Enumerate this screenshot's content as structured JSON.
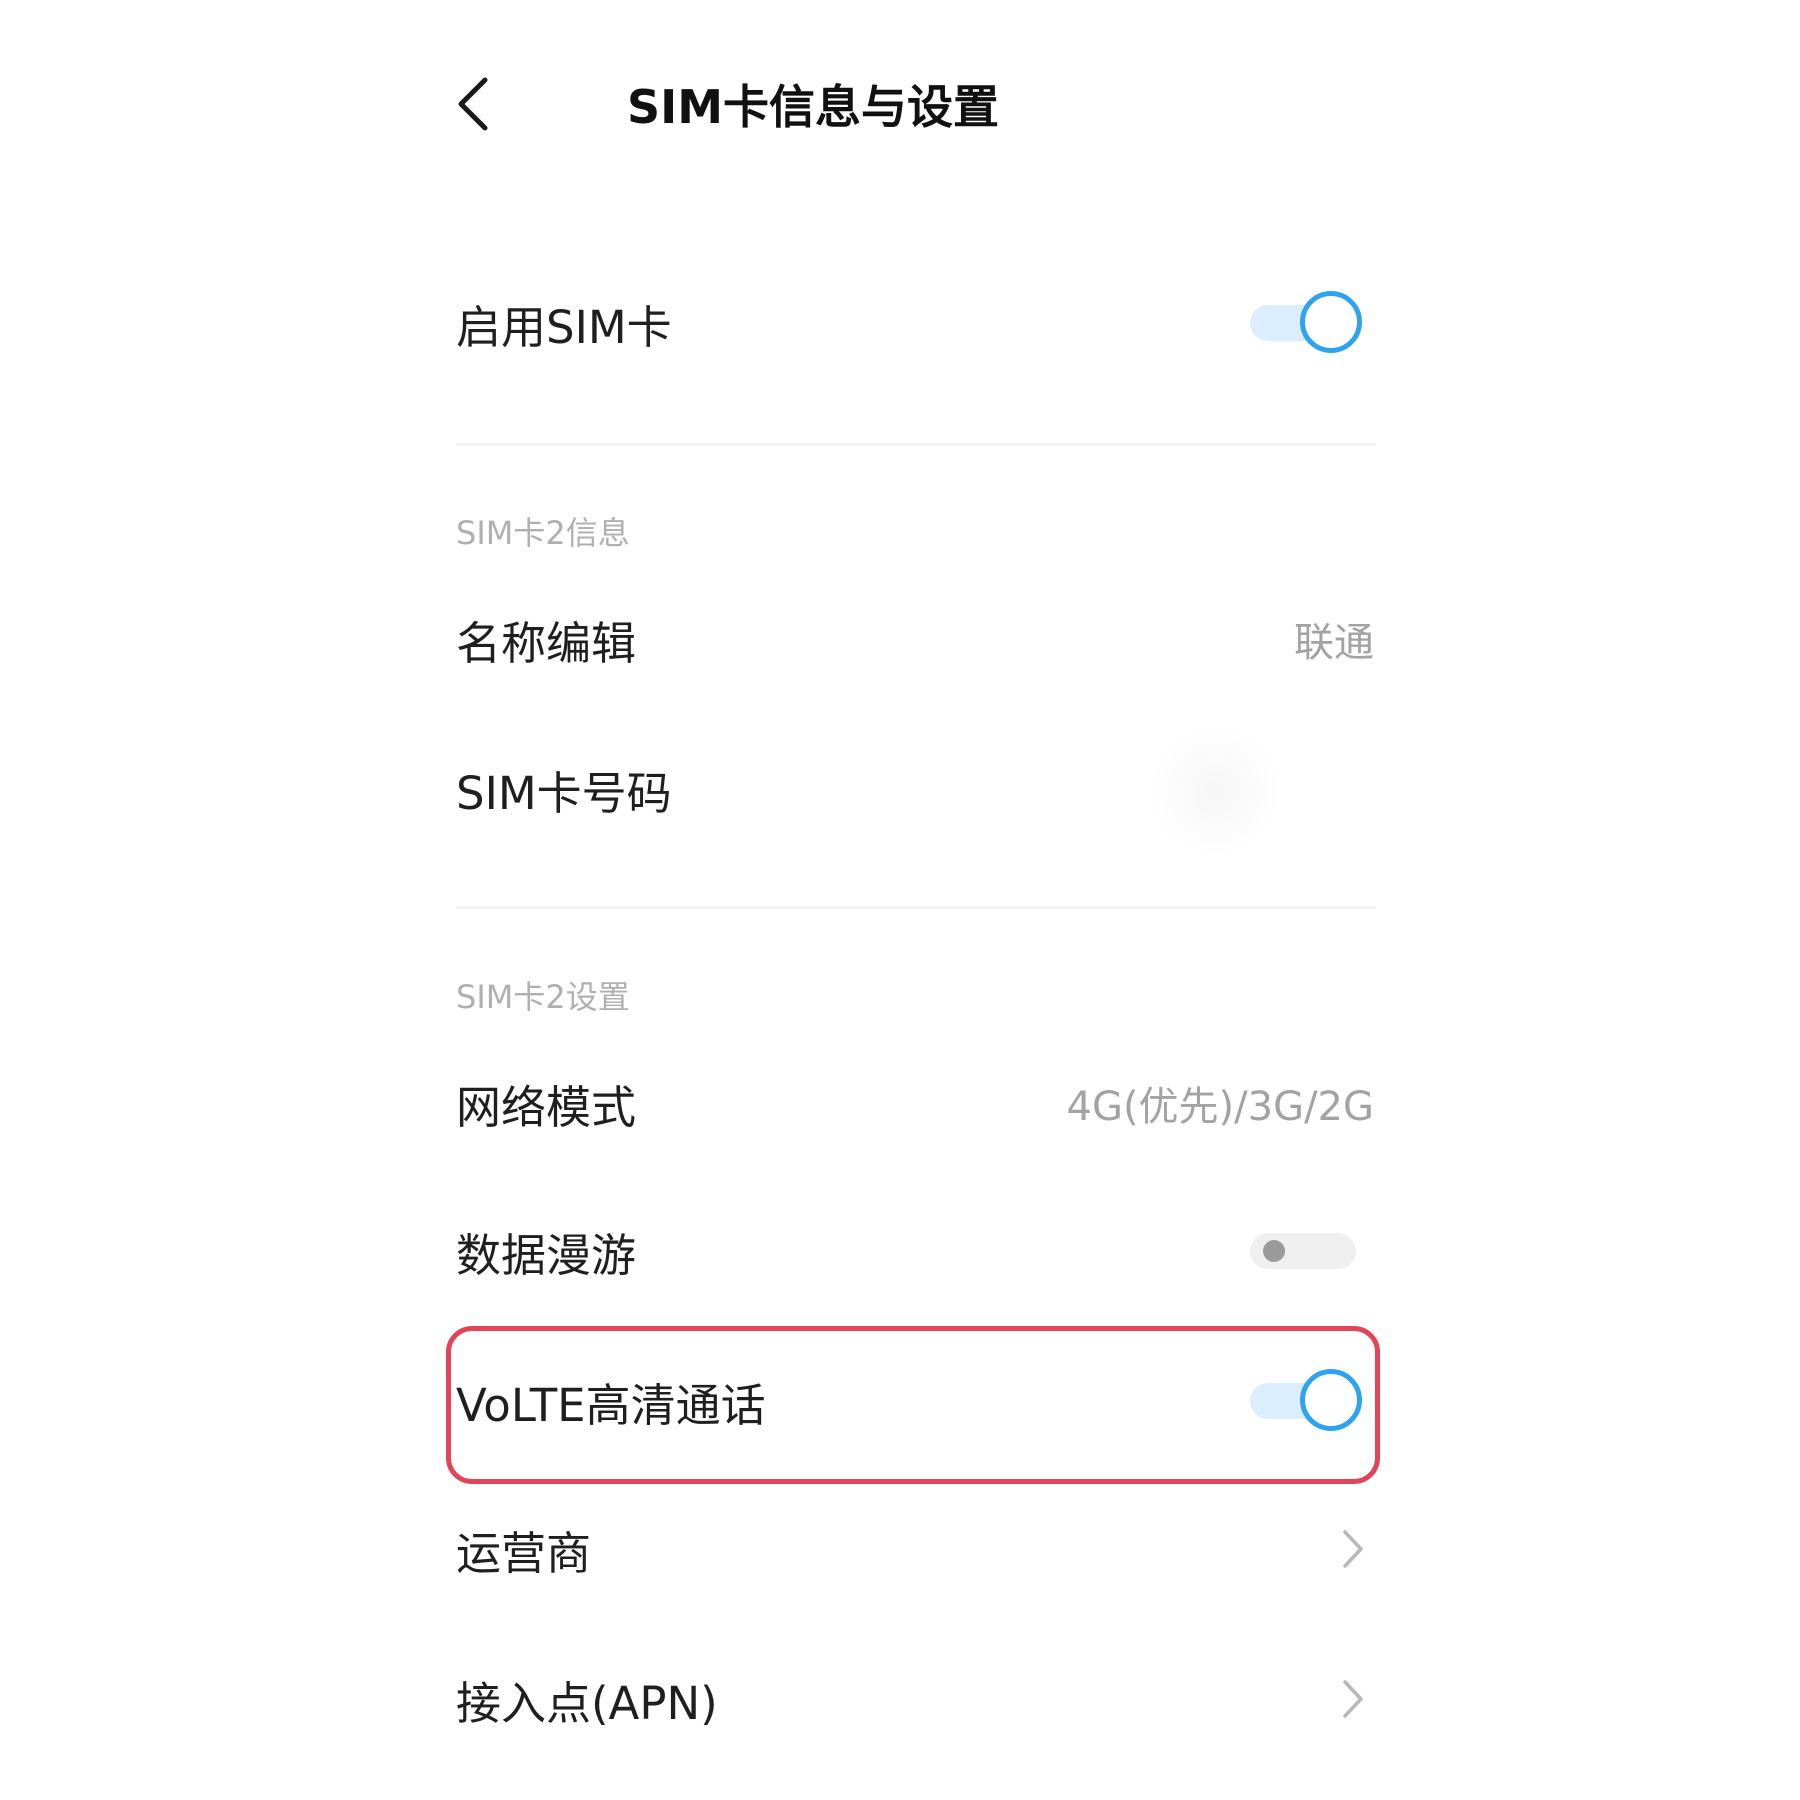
{
  "header": {
    "back_icon": "chevron-left-icon",
    "title": "SIM卡信息与设置"
  },
  "enable_sim": {
    "label": "启用SIM卡",
    "toggle_on": true
  },
  "sim_info_section": {
    "title": "SIM卡2信息",
    "items": [
      {
        "label": "名称编辑",
        "value": "联通"
      },
      {
        "label": "SIM卡号码",
        "value": ""
      }
    ]
  },
  "sim_settings_section": {
    "title": "SIM卡2设置",
    "network_mode": {
      "label": "网络模式",
      "value": "4G(优先)/3G/2G"
    },
    "data_roaming": {
      "label": "数据漫游",
      "toggle_on": false
    },
    "volte": {
      "label": "VoLTE高清通话",
      "toggle_on": true
    },
    "carrier": {
      "label": "运营商",
      "icon": "chevron-right-icon"
    },
    "apn": {
      "label": "接入点(APN)",
      "icon": "chevron-right-icon"
    }
  },
  "colors": {
    "accent": "#2fa3f0",
    "highlight": "#e0455a",
    "secondary_text": "#a3a3a3"
  }
}
